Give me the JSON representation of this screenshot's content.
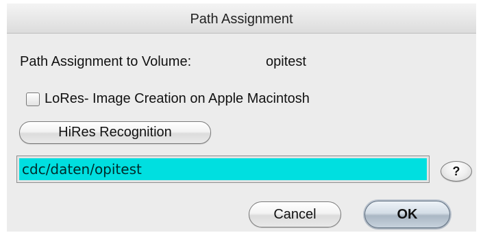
{
  "dialog": {
    "title": "Path Assignment",
    "volume_label": "Path Assignment to Volume:",
    "volume_name": "opitest",
    "lores_checkbox": {
      "label": "LoRes- Image Creation on Apple Macintosh",
      "checked": false
    },
    "hires_button_label": "HiRes Recognition",
    "path_input": {
      "value": "cdc/daten/opitest",
      "highlight_color": "#00dfe0"
    },
    "help_button_label": "?",
    "cancel_label": "Cancel",
    "ok_label": "OK"
  }
}
